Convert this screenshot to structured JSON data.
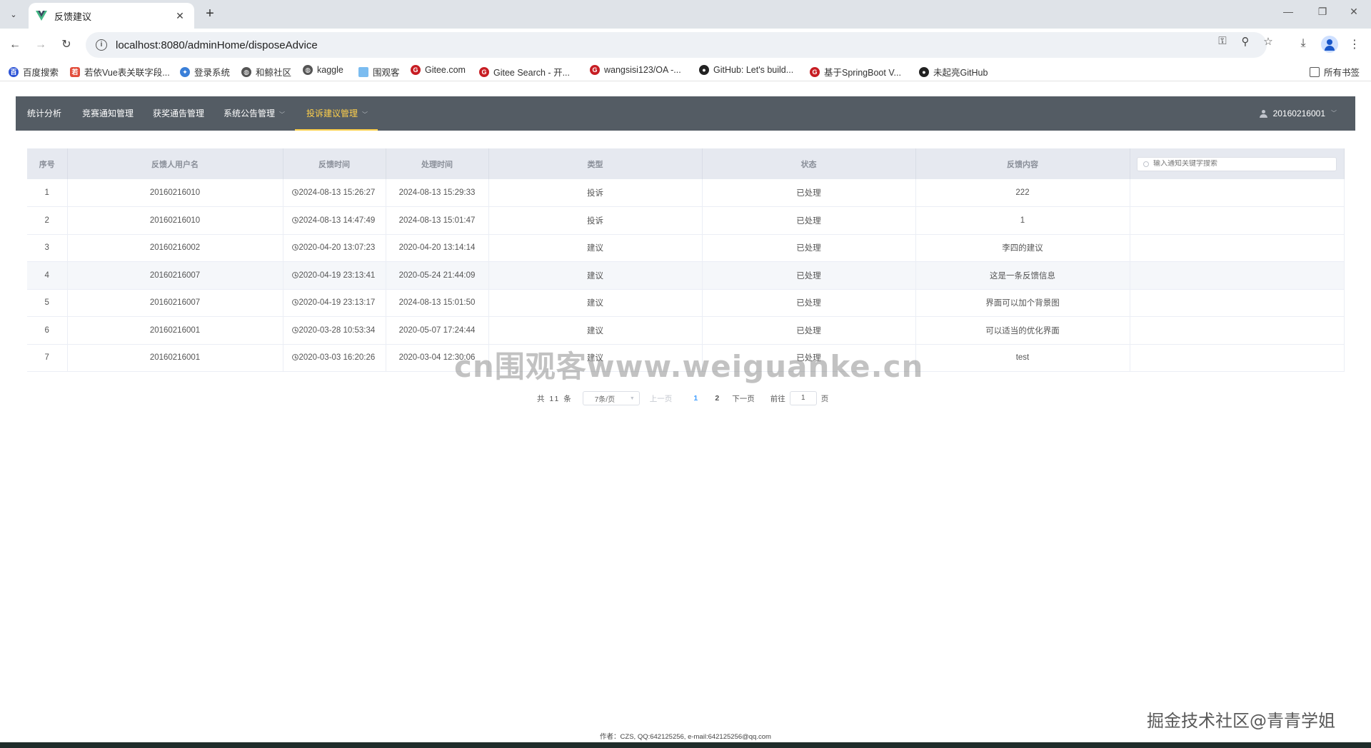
{
  "browser": {
    "tab_title": "反馈建议",
    "url": "localhost:8080/adminHome/disposeAdvice",
    "bookmarks": [
      "百度搜索",
      "若依Vue表关联字段...",
      "登录系统",
      "和鲸社区",
      "kaggle",
      "围观客",
      "Gitee.com",
      "Gitee Search - 开...",
      "wangsisi123/OA -...",
      "GitHub: Let's build...",
      "基于SpringBoot V...",
      "未起亮GitHub"
    ],
    "all_bookmarks": "所有书签"
  },
  "nav": {
    "items": [
      {
        "label": "统计分析",
        "has_dropdown": false
      },
      {
        "label": "竞赛通知管理",
        "has_dropdown": false
      },
      {
        "label": "获奖通告管理",
        "has_dropdown": false
      },
      {
        "label": "系统公告管理",
        "has_dropdown": true
      },
      {
        "label": "投诉建议管理",
        "has_dropdown": true
      }
    ],
    "active_index": 4,
    "active_color": "#ffd04b",
    "user": "20160216001"
  },
  "table": {
    "headers": [
      "序号",
      "反馈人用户名",
      "反馈时间",
      "处理时间",
      "类型",
      "状态",
      "反馈内容"
    ],
    "search_placeholder": "输入通知关键字搜索",
    "rows": [
      {
        "index": "1",
        "user": "20160216010",
        "feedback_time": "2024-08-13 15:26:27",
        "handle_time": "2024-08-13 15:29:33",
        "type": "投诉",
        "status": "已处理",
        "content": "222"
      },
      {
        "index": "2",
        "user": "20160216010",
        "feedback_time": "2024-08-13 14:47:49",
        "handle_time": "2024-08-13 15:01:47",
        "type": "投诉",
        "status": "已处理",
        "content": "1"
      },
      {
        "index": "3",
        "user": "20160216002",
        "feedback_time": "2020-04-20 13:07:23",
        "handle_time": "2020-04-20 13:14:14",
        "type": "建议",
        "status": "已处理",
        "content": "李四的建议"
      },
      {
        "index": "4",
        "user": "20160216007",
        "feedback_time": "2020-04-19 23:13:41",
        "handle_time": "2020-05-24 21:44:09",
        "type": "建议",
        "status": "已处理",
        "content": "这是一条反馈信息"
      },
      {
        "index": "5",
        "user": "20160216007",
        "feedback_time": "2020-04-19 23:13:17",
        "handle_time": "2024-08-13 15:01:50",
        "type": "建议",
        "status": "已处理",
        "content": "界面可以加个背景图"
      },
      {
        "index": "6",
        "user": "20160216001",
        "feedback_time": "2020-03-28 10:53:34",
        "handle_time": "2020-05-07 17:24:44",
        "type": "建议",
        "status": "已处理",
        "content": "可以适当的优化界面"
      },
      {
        "index": "7",
        "user": "20160216001",
        "feedback_time": "2020-03-03 16:20:26",
        "handle_time": "2020-03-04 12:30:06",
        "type": "建议",
        "status": "已处理",
        "content": "test"
      }
    ],
    "hover_row": 3
  },
  "pagination": {
    "total_prefix": "共",
    "total": "11",
    "total_suffix": "条",
    "page_size": "7条/页",
    "prev": "上一页",
    "pages": [
      "1",
      "2"
    ],
    "current_page": "1",
    "next": "下一页",
    "goto_prefix": "前往",
    "goto_value": "1",
    "goto_suffix": "页"
  },
  "footer": {
    "author": "作者：CZS, QQ:642125256, e-mail:642125256@qq.com"
  },
  "watermarks": {
    "center": "cn围观客www.weiguanke.cn",
    "bottom_right": "掘金技术社区@青青学姐"
  }
}
